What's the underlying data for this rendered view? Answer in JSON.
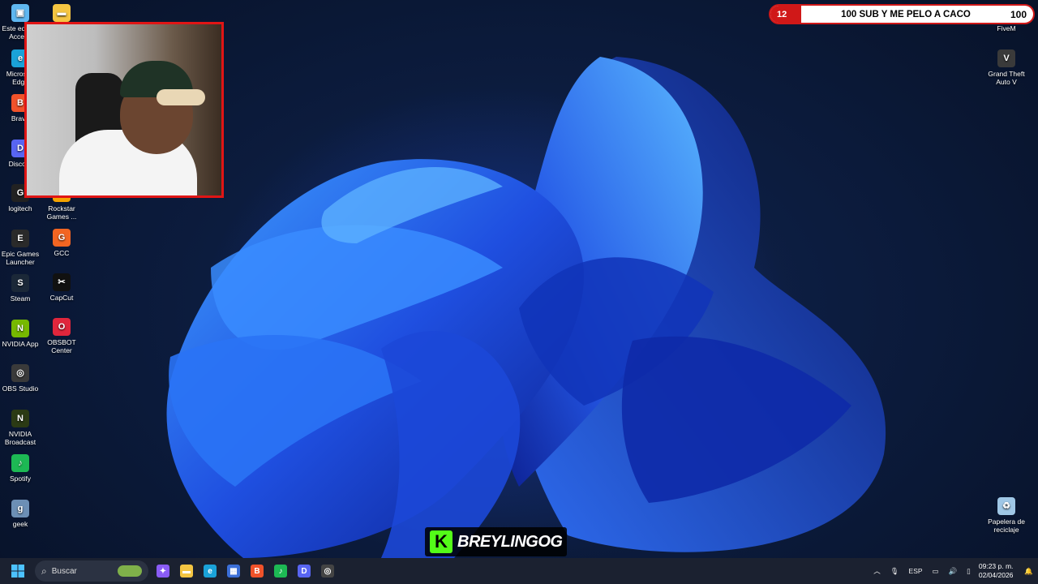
{
  "desktop_left": [
    {
      "label": "Este equipo\nAcceso",
      "icon": "this-pc-icon",
      "color": "#5fb7f0",
      "glyph": "▣"
    },
    {
      "label": "Microsoft\nEdge",
      "icon": "edge-icon",
      "color": "#1aa2d8",
      "glyph": "e"
    },
    {
      "label": "Brave",
      "icon": "brave-icon",
      "color": "#f0522a",
      "glyph": "B"
    },
    {
      "label": "Discord",
      "icon": "discord-icon",
      "color": "#5865f2",
      "glyph": "D"
    },
    {
      "label": "logitech",
      "icon": "logitech-icon",
      "color": "#222222",
      "glyph": "G"
    },
    {
      "label": "Epic Games\nLauncher",
      "icon": "epic-games-icon",
      "color": "#2a2a2a",
      "glyph": "E"
    },
    {
      "label": "Steam",
      "icon": "steam-icon",
      "color": "#1b2838",
      "glyph": "S"
    },
    {
      "label": "NVIDIA App",
      "icon": "nvidia-app-icon",
      "color": "#76b900",
      "glyph": "N"
    },
    {
      "label": "OBS Studio",
      "icon": "obs-studio-icon",
      "color": "#3a3a3a",
      "glyph": "◎"
    },
    {
      "label": "NVIDIA\nBroadcast",
      "icon": "nvidia-broadcast-icon",
      "color": "#2b3a14",
      "glyph": "N"
    },
    {
      "label": "Spotify",
      "icon": "spotify-icon",
      "color": "#1db954",
      "glyph": "♪"
    },
    {
      "label": "geek",
      "icon": "geek-icon",
      "color": "#6c8fb5",
      "glyph": "g"
    }
  ],
  "desktop_second": [
    {
      "label": "",
      "icon": "folder-icon",
      "color": "#f4c542",
      "glyph": "▬"
    },
    {
      "label": "Rockstar\nGames ...",
      "icon": "rockstar-icon",
      "color": "#f4a300",
      "glyph": "R"
    },
    {
      "label": "GCC",
      "icon": "gcc-icon",
      "color": "#f26522",
      "glyph": "G"
    },
    {
      "label": "CapCut",
      "icon": "capcut-icon",
      "color": "#111111",
      "glyph": "✂"
    },
    {
      "label": "OBSBOT\nCenter",
      "icon": "obsbot-icon",
      "color": "#e0263c",
      "glyph": "O"
    }
  ],
  "desktop_right": [
    {
      "label": "FiveM",
      "icon": "fivem-icon",
      "color": "#f26a22",
      "glyph": "F"
    },
    {
      "label": "Grand Theft\nAuto V",
      "icon": "gta-v-icon",
      "color": "#3a3a3a",
      "glyph": "V"
    },
    {
      "label": "Papelera de\nreciclaje",
      "icon": "recycle-bin-icon",
      "color": "#9fc7e6",
      "glyph": "♻"
    }
  ],
  "sub_goal": {
    "current": "12",
    "text": "100 SUB Y ME PELO A CACO",
    "target": "100",
    "progress": 0.12
  },
  "streamer": {
    "name": "BREYLINGOG",
    "logo_letter": "K"
  },
  "taskbar": {
    "search_placeholder": "Buscar",
    "apps": [
      {
        "icon": "copilot-icon",
        "color": "#8a5cf6",
        "glyph": "✦"
      },
      {
        "icon": "file-explorer-icon",
        "color": "#f4c542",
        "glyph": "▬"
      },
      {
        "icon": "edge-icon",
        "color": "#1aa2d8",
        "glyph": "e"
      },
      {
        "icon": "store-icon",
        "color": "#3b6fd8",
        "glyph": "▦"
      },
      {
        "icon": "brave-icon",
        "color": "#f0522a",
        "glyph": "B"
      },
      {
        "icon": "spotify-icon",
        "color": "#1db954",
        "glyph": "♪"
      },
      {
        "icon": "discord-icon",
        "color": "#5865f2",
        "glyph": "D"
      },
      {
        "icon": "obs-icon",
        "color": "#444444",
        "glyph": "◎"
      }
    ],
    "tray": {
      "language": "ESP",
      "time": "09:23 p. m.",
      "date": "02/04/2026"
    }
  }
}
